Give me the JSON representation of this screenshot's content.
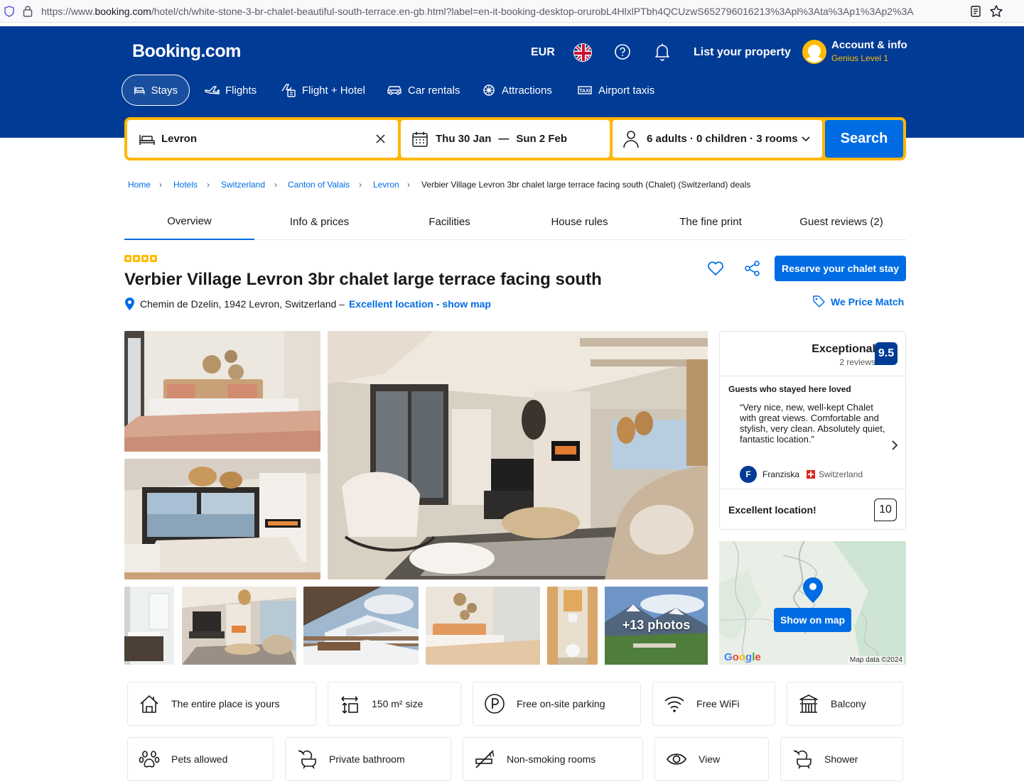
{
  "browser": {
    "url_prefix": "https://www.",
    "url_host": "booking.com",
    "url_rest": "/hotel/ch/white-stone-3-br-chalet-beautiful-south-terrace.en-gb.html?label=en-it-booking-desktop-orurobL4HlxlPTbh4QCUzwS652796016213%3Apl%3Ata%3Ap1%3Ap2%3A"
  },
  "header": {
    "logo": "Booking.com",
    "currency": "EUR",
    "list_property": "List your property",
    "account_title": "Account & info",
    "account_level": "Genius Level 1",
    "nav": [
      {
        "label": "Stays",
        "icon": "bed-icon"
      },
      {
        "label": "Flights",
        "icon": "plane-icon"
      },
      {
        "label": "Flight + Hotel",
        "icon": "flight-hotel-icon"
      },
      {
        "label": "Car rentals",
        "icon": "car-icon"
      },
      {
        "label": "Attractions",
        "icon": "attractions-icon"
      },
      {
        "label": "Airport taxis",
        "icon": "taxi-icon"
      }
    ]
  },
  "search": {
    "destination": "Levron",
    "check_in": "Thu 30 Jan",
    "dash": "—",
    "check_out": "Sun 2 Feb",
    "guests": "6 adults · 0 children · 3 rooms",
    "button": "Search"
  },
  "breadcrumb": [
    "Home",
    "Hotels",
    "Switzerland",
    "Canton of Valais",
    "Levron",
    "Verbier Village Levron 3br chalet large terrace facing south (Chalet) (Switzerland) deals"
  ],
  "page_tabs": [
    "Overview",
    "Info & prices",
    "Facilities",
    "House rules",
    "The fine print",
    "Guest reviews (2)"
  ],
  "property": {
    "stars": 4,
    "title": "Verbier Village Levron 3br chalet large terrace facing south",
    "address": "Chemin de Dzelin, 1942 Levron, Switzerland –",
    "location_link": "Excellent location - show map",
    "reserve": "Reserve your chalet stay",
    "price_match": "We Price Match"
  },
  "gallery": {
    "more_photos": "+13 photos"
  },
  "review": {
    "label": "Exceptional",
    "count": "2 reviews",
    "score": "9.5",
    "loved_title": "Guests who stayed here loved",
    "quote": "“Very nice, new, well-kept Chalet with great views. Comfortable and stylish, very clean. Absolutely quiet, fantastic location.”",
    "author_initial": "F",
    "author": "Franziska",
    "country": "Switzerland",
    "location_label": "Excellent location!",
    "location_score": "10"
  },
  "map": {
    "button": "Show on map",
    "google": "Google",
    "data": "Map data ©2024"
  },
  "facilities": [
    {
      "label": "The entire place is yours",
      "icon": "house-icon"
    },
    {
      "label": "150 m² size",
      "icon": "size-icon"
    },
    {
      "label": "Free on-site parking",
      "icon": "parking-icon"
    },
    {
      "label": "Free WiFi",
      "icon": "wifi-icon"
    },
    {
      "label": "Balcony",
      "icon": "balcony-icon"
    },
    {
      "label": "Pets allowed",
      "icon": "paw-icon"
    },
    {
      "label": "Private bathroom",
      "icon": "bath-icon"
    },
    {
      "label": "Non-smoking rooms",
      "icon": "no-smoking-icon"
    },
    {
      "label": "View",
      "icon": "eye-icon"
    },
    {
      "label": "Shower",
      "icon": "shower-icon"
    }
  ],
  "colors": {
    "brand_blue": "#003b95",
    "action_blue": "#006ce4",
    "search_yellow": "#ffb700",
    "genius_yellow": "#febb02"
  }
}
